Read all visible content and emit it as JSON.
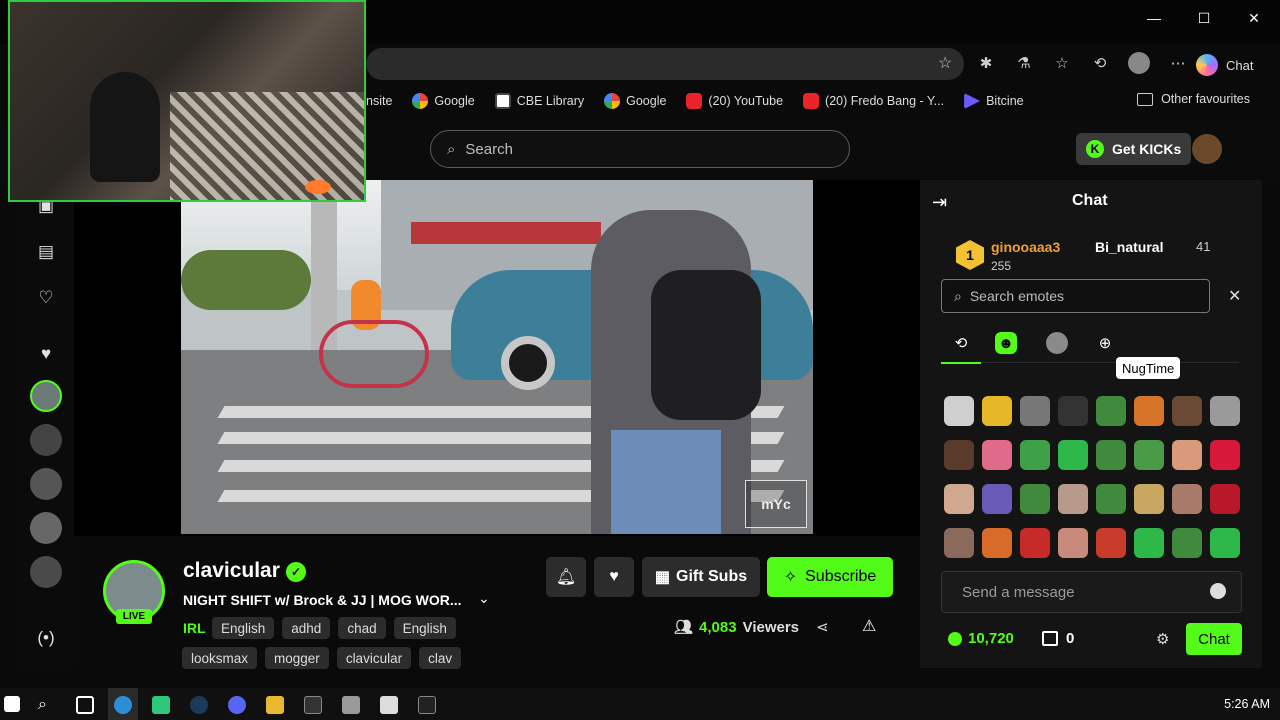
{
  "browser": {
    "copilot_label": "Chat",
    "bookmarks": [
      {
        "label": "nsite",
        "icon": "none"
      },
      {
        "label": "Google",
        "icon": "google-icon"
      },
      {
        "label": "CBE Library",
        "icon": "library-icon"
      },
      {
        "label": "Google",
        "icon": "google-icon"
      },
      {
        "label": "(20) YouTube",
        "icon": "youtube-icon"
      },
      {
        "label": "(20) Fredo Bang - Y...",
        "icon": "youtube-icon"
      },
      {
        "label": "Bitcine",
        "icon": "bitcine-icon"
      }
    ],
    "other_favourites": "Other favourites"
  },
  "header": {
    "search_placeholder": "Search",
    "get_kicks_label": "Get KICKs"
  },
  "channel": {
    "name": "clavicular",
    "live_label": "LIVE",
    "title": "NIGHT SHIFT w/ Brock & JJ | MOG WOR...",
    "category": "IRL",
    "tags_row1": [
      "English",
      "adhd",
      "chad",
      "English"
    ],
    "tags_row2": [
      "looksmax",
      "mogger",
      "clavicular",
      "clav"
    ],
    "gift_label": "Gift Subs",
    "subscribe_label": "Subscribe",
    "viewer_count": "4,083",
    "viewer_suffix": "Viewers"
  },
  "video": {
    "watermark": "mYc"
  },
  "chat": {
    "title": "Chat",
    "leaderboard": {
      "first_rank": "1",
      "first_name": "ginooaaa3",
      "first_count": "255",
      "second_name": "Bi_natural",
      "second_count": "41"
    },
    "emote_search_placeholder": "Search emotes",
    "tooltip": "NugTime",
    "message_placeholder": "Send a message",
    "points": "10,720",
    "store_count": "0",
    "send_label": "Chat"
  },
  "taskbar": {
    "clock": "5:26 AM"
  },
  "colors": {
    "accent": "#53fc18",
    "background": "#0b0b0b",
    "panel": "#141414"
  }
}
